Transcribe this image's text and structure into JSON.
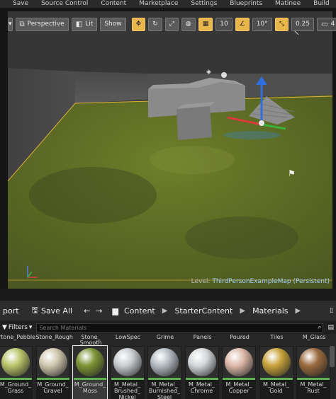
{
  "menu": [
    "Save",
    "Source Control",
    "Content",
    "Marketplace",
    "Settings",
    "Blueprints",
    "Matinee",
    "Build"
  ],
  "viewport": {
    "perspective": "Perspective",
    "lit": "Lit",
    "show": "Show",
    "grid_snap": "10",
    "rot_snap": "10°",
    "scale_snap": "0.25",
    "cam_speed": "4",
    "level_label": "Level:",
    "level_name": "ThirdPersonExampleMap (Persistent)"
  },
  "content_browser": {
    "import_label": "port",
    "save_all_label": "Save All",
    "breadcrumb": [
      "Content",
      "StarterContent",
      "Materials"
    ],
    "filters_label": "Filters",
    "search_placeholder": "Search Materials",
    "top_labels": [
      "rtone_Pebble",
      "Stone_Rough",
      "Stone_\nSmooth",
      "LowSpec",
      "Grime",
      "Panels",
      "Poured",
      "Tiles",
      "M_Glass"
    ],
    "assets": [
      {
        "name": "M_Ground_\nGrass",
        "color": "#b9c46a"
      },
      {
        "name": "M_Ground_\nGravel",
        "color": "#cfc6ad"
      },
      {
        "name": "M_Ground_\nMoss",
        "color": "#7d9435"
      },
      {
        "name": "M_Metal_\nBrushed_\nNickel",
        "color": "#c9cdd1"
      },
      {
        "name": "M_Metal_\nBurnished_\nSteel",
        "color": "#b5bcc2"
      },
      {
        "name": "M_Metal_\nChrome",
        "color": "#d4d7da"
      },
      {
        "name": "M_Metal_\nCopper",
        "color": "#dcb8a8"
      },
      {
        "name": "M_Metal_\nGold",
        "color": "#c8a23a"
      },
      {
        "name": "M_Metal_\nRust",
        "color": "#9a6a3e"
      }
    ]
  }
}
